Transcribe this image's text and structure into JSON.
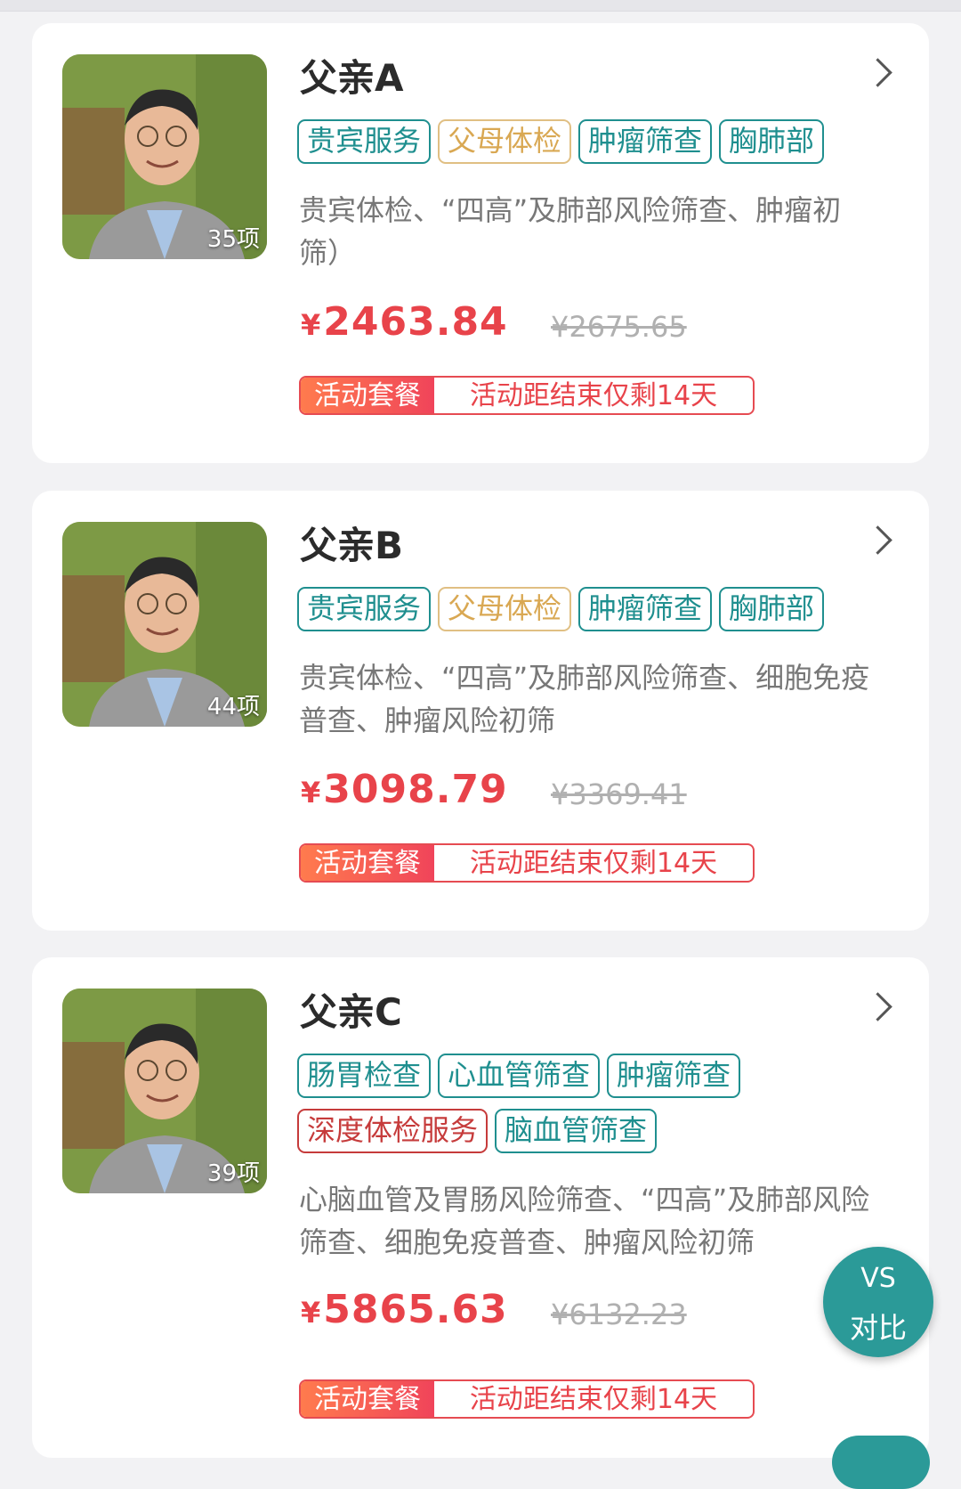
{
  "packages": [
    {
      "title": "父亲A",
      "count": "35项",
      "tags": [
        {
          "label": "贵宾服务",
          "style": "teal"
        },
        {
          "label": "父母体检",
          "style": "gold"
        },
        {
          "label": "肿瘤筛查",
          "style": "teal"
        },
        {
          "label": "胸肺部",
          "style": "teal"
        }
      ],
      "description": "贵宾体检、“四高”及肺部风险筛查、肿瘤初筛）",
      "currency": "¥",
      "price": "2463.84",
      "original_price": "¥2675.65",
      "badge_label": "活动套餐",
      "badge_text": "活动距结束仅剩14天"
    },
    {
      "title": "父亲B",
      "count": "44项",
      "tags": [
        {
          "label": "贵宾服务",
          "style": "teal"
        },
        {
          "label": "父母体检",
          "style": "gold"
        },
        {
          "label": "肿瘤筛查",
          "style": "teal"
        },
        {
          "label": "胸肺部",
          "style": "teal"
        }
      ],
      "description": "贵宾体检、“四高”及肺部风险筛查、细胞免疫普查、肿瘤风险初筛",
      "currency": "¥",
      "price": "3098.79",
      "original_price": "¥3369.41",
      "badge_label": "活动套餐",
      "badge_text": "活动距结束仅剩14天"
    },
    {
      "title": "父亲C",
      "count": "39项",
      "tags": [
        {
          "label": "肠胃检查",
          "style": "teal"
        },
        {
          "label": "心血管筛查",
          "style": "teal"
        },
        {
          "label": "肿瘤筛查",
          "style": "teal"
        },
        {
          "label": "深度体检服务",
          "style": "red"
        },
        {
          "label": "脑血管筛查",
          "style": "teal"
        }
      ],
      "description": "心脑血管及胃肠风险筛查、“四高”及肺部风险筛查、细胞免疫普查、肿瘤风险初筛",
      "currency": "¥",
      "price": "5865.63",
      "original_price": "¥6132.23",
      "badge_label": "活动套餐",
      "badge_text": "活动距结束仅剩14天"
    }
  ],
  "compare_button": {
    "line1": "VS",
    "line2": "对比"
  },
  "colors": {
    "teal": "#1f8f8f",
    "gold": "#d9a853",
    "red": "#c63b3b",
    "price": "#e8434a",
    "fab": "#2b9a98"
  }
}
